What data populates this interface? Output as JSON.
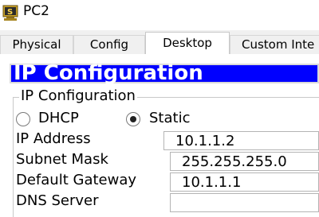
{
  "window": {
    "title": "PC2",
    "icon": "pc-icon"
  },
  "tabs": [
    {
      "label": "Physical",
      "active": false
    },
    {
      "label": "Config",
      "active": false
    },
    {
      "label": "Desktop",
      "active": true
    },
    {
      "label": "Custom Inte",
      "active": false
    }
  ],
  "ip_config": {
    "header": "IP Configuration",
    "group_title": "IP Configuration",
    "mode": {
      "dhcp_label": "DHCP",
      "static_label": "Static",
      "selected": "Static"
    },
    "fields": {
      "ip_address": {
        "label": "IP Address",
        "value": "10.1.1.2"
      },
      "subnet_mask": {
        "label": "Subnet Mask",
        "value": "255.255.255.0"
      },
      "default_gateway": {
        "label": "Default Gateway",
        "value": "10.1.1.1"
      },
      "dns_server": {
        "label": "DNS Server",
        "value": ""
      }
    }
  },
  "colors": {
    "header_bg": "#0000ff",
    "header_text": "#ffffff"
  }
}
